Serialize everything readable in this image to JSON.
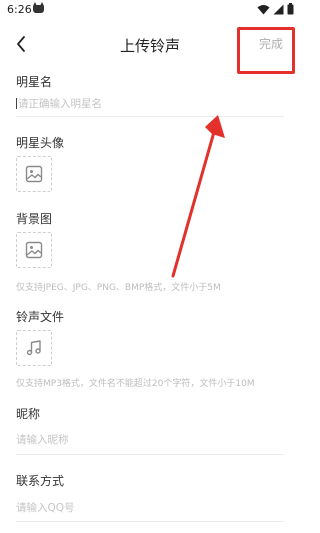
{
  "status_bar": {
    "time": "6:26"
  },
  "header": {
    "title": "上传铃声",
    "done_label": "完成"
  },
  "fields": {
    "star_name": {
      "label": "明星名",
      "placeholder": "请正确输入明星名"
    },
    "star_avatar": {
      "label": "明星头像"
    },
    "background": {
      "label": "背景图",
      "hint": "仅支持JPEG、JPG、PNG、BMP格式，文件小于5M"
    },
    "ringtone_file": {
      "label": "铃声文件",
      "hint": "仅支持MP3格式，文件名不能超过20个字符，文件小于10M"
    },
    "nickname": {
      "label": "昵称",
      "placeholder": "请输入昵称"
    },
    "contact": {
      "label": "联系方式",
      "placeholder": "请输入QQ号"
    }
  },
  "colors": {
    "annotation_red": "#e3302a",
    "placeholder_gray": "#c4c4c4",
    "done_gray": "#b0b0b0"
  }
}
